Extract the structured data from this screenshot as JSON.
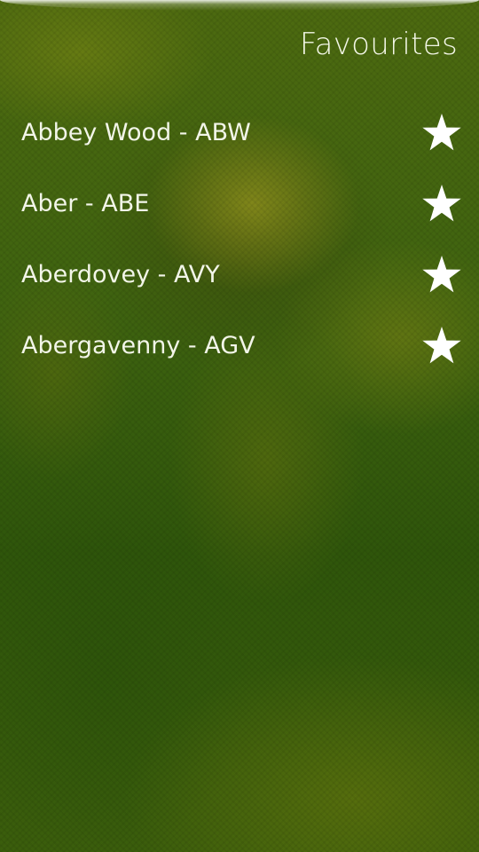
{
  "header": {
    "title": "Favourites"
  },
  "favourites": [
    {
      "label": "Abbey Wood - ABW",
      "icon": "star-icon",
      "starred": true
    },
    {
      "label": "Aber - ABE",
      "icon": "star-icon",
      "starred": true
    },
    {
      "label": "Aberdovey - AVY",
      "icon": "star-icon",
      "starred": true
    },
    {
      "label": "Abergavenny - AGV",
      "icon": "star-icon",
      "starred": true
    }
  ],
  "colors": {
    "text": "#f2f5e8",
    "background": "#3f6410",
    "star": "#ffffff"
  }
}
